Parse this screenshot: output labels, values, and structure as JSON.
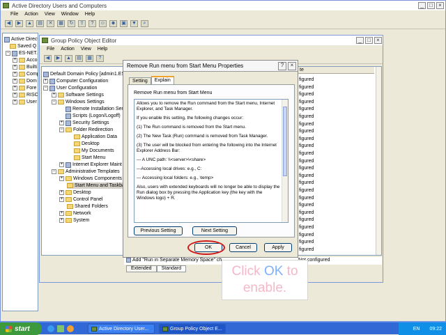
{
  "adwin": {
    "title": "Active Directory Users and Computers",
    "menu": [
      "File",
      "Action",
      "View",
      "Window",
      "Help"
    ],
    "tree": [
      {
        "label": "Active Direct"
      },
      {
        "label": "Saved Q"
      },
      {
        "label": "ES-NET.c"
      },
      {
        "label": "Acco"
      },
      {
        "label": "Builti"
      },
      {
        "label": "Comp"
      },
      {
        "label": "Dom"
      },
      {
        "label": "Fore"
      },
      {
        "label": "RISC"
      },
      {
        "label": "User"
      }
    ]
  },
  "gpwin": {
    "title": "Group Policy Object Editor",
    "menu": [
      "File",
      "Action",
      "View",
      "Help"
    ],
    "tree": [
      {
        "label": "Default Domain Policy [admin1.ES-N"
      },
      {
        "label": "Computer Configuration"
      },
      {
        "label": "User Configuration"
      },
      {
        "label": "Software Settings"
      },
      {
        "label": "Windows Settings"
      },
      {
        "label": "Remote Installation Ser"
      },
      {
        "label": "Scripts (Logon/Logoff)"
      },
      {
        "label": "Security Settings"
      },
      {
        "label": "Folder Redirection"
      },
      {
        "label": "Application Data"
      },
      {
        "label": "Desktop"
      },
      {
        "label": "My Documents"
      },
      {
        "label": "Start Menu"
      },
      {
        "label": "Internet Explorer Maint"
      },
      {
        "label": "Administrative Templates"
      },
      {
        "label": "Windows Components"
      },
      {
        "label": "Start Menu and Taskbar"
      },
      {
        "label": "Desktop"
      },
      {
        "label": "Control Panel"
      },
      {
        "label": "Shared Folders"
      },
      {
        "label": "Network"
      },
      {
        "label": "System"
      }
    ],
    "right_column_header": "te",
    "right_values": [
      "figured",
      "figured",
      "figured",
      "figured",
      "figured",
      "figured",
      "figured",
      "figured",
      "figured",
      "figured",
      "figured",
      "figured",
      "figured",
      "figured",
      "figured",
      "figured",
      "figured",
      "figured",
      "figured",
      "figured",
      "figured",
      "figured",
      "figured",
      "figured"
    ],
    "bottom_item": "Add \"Run in Separate Memory Space\" ch",
    "bottom_status": "Not configured",
    "tabs": [
      "Extended",
      "Standard"
    ]
  },
  "dialog": {
    "title": "Remove Run menu from Start Menu Properties",
    "tabs": [
      "Setting",
      "Explain"
    ],
    "heading": "Remove Run menu from Start Menu",
    "paragraphs": [
      "Allows you to remove the Run command from the Start menu, Internet Explorer, and Task Manager.",
      "If you enable this setting, the following changes occur:",
      "(1) The Run command is removed from the Start menu.",
      "(2) The New Task (Run) command is removed from Task Manager.",
      "(3) The user will be blocked from entering the following into the Internet Explorer Address Bar:",
      "--- A UNC path: \\\\<server>\\<share>",
      "---Accessing local drives:  e.g., C:",
      "--- Accessing local folders: e.g., \\temp>",
      "Also, users with extended keyboards will no longer be able to display the Run dialog box by pressing the Application key (the key with the Windows logo) + R."
    ],
    "prev_button": "Previous Setting",
    "next_button": "Next Setting",
    "ok_button": "OK",
    "cancel_button": "Cancel",
    "apply_button": "Apply"
  },
  "callout": {
    "line1_a": "Click ",
    "line1_b": "OK",
    "line1_c": " to",
    "line2": "enable."
  },
  "taskbar": {
    "start": "start",
    "buttons": [
      "Active Directory User...",
      "Group Policy Object E..."
    ],
    "lang": "EN",
    "clock": "09:22"
  },
  "colors": {
    "accent_red": "#d01818",
    "callout_text": "#f4b8c8",
    "callout_ok": "#7fb0ff"
  }
}
